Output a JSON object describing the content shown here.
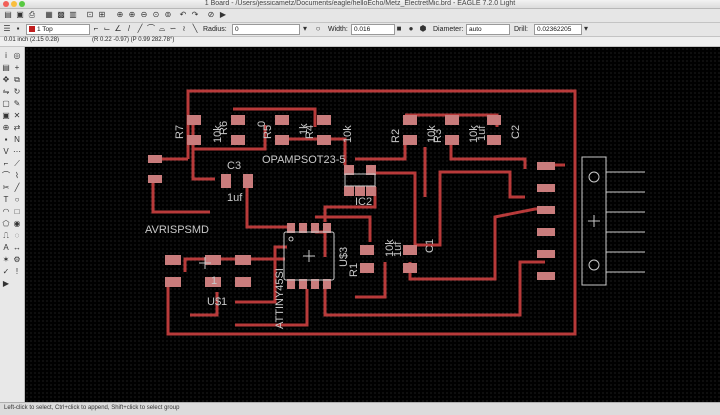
{
  "window": {
    "title": "1 Board - /Users/jessicametz/Documents/eagle/helloEcho/Metz_ElectretMic.brd - EAGLE 7.2.0 Light"
  },
  "toolbar2": {
    "layer_value": "1 Top",
    "radius_label": "Radius:",
    "radius_value": "0",
    "width_label": "Width:",
    "width_value": "0.016",
    "diameter_label": "Diameter:",
    "diameter_value": "auto",
    "drill_label": "Drill:",
    "drill_value": "0.02362205"
  },
  "toolbar3": {
    "grid_value": "0.01 inch (2.15 0.28)",
    "coord_readout": "(R 0.22 -0.97) (P 0.99 282.78°)"
  },
  "board": {
    "labels": {
      "r7_name": "R7",
      "r7_val": "10k",
      "r6_name": "R6",
      "r6_val": "0",
      "r5_name": "R5",
      "r5_val": "1k",
      "r4_name": "R4",
      "r4_val": "10k",
      "r2_name": "R2",
      "r2_val": "10k",
      "r3_name": "R3",
      "r3_val": "10k",
      "c2_val": "1uf",
      "c2_name": "C2",
      "c3_name": "C3",
      "c3_val": "1uf",
      "opamp": "OPAMPSOT23-5",
      "ic2": "IC2",
      "avrisp": "AVRISPSMD",
      "attiny": "ATTINY45SI",
      "us3": "U$3",
      "r1_name": "R1",
      "r1_val": "10k",
      "c1_val": "1uf",
      "c1_name": "C1",
      "pin1": "1",
      "us1": "U$1"
    }
  },
  "colors": {
    "trace": "#b83a3a",
    "pad": "#c97c7c",
    "canvas": "#000000",
    "silk": "#c8c8c8"
  },
  "status": {
    "text": "Left-click to select, Ctrl+click to append, Shift+click to select group"
  }
}
